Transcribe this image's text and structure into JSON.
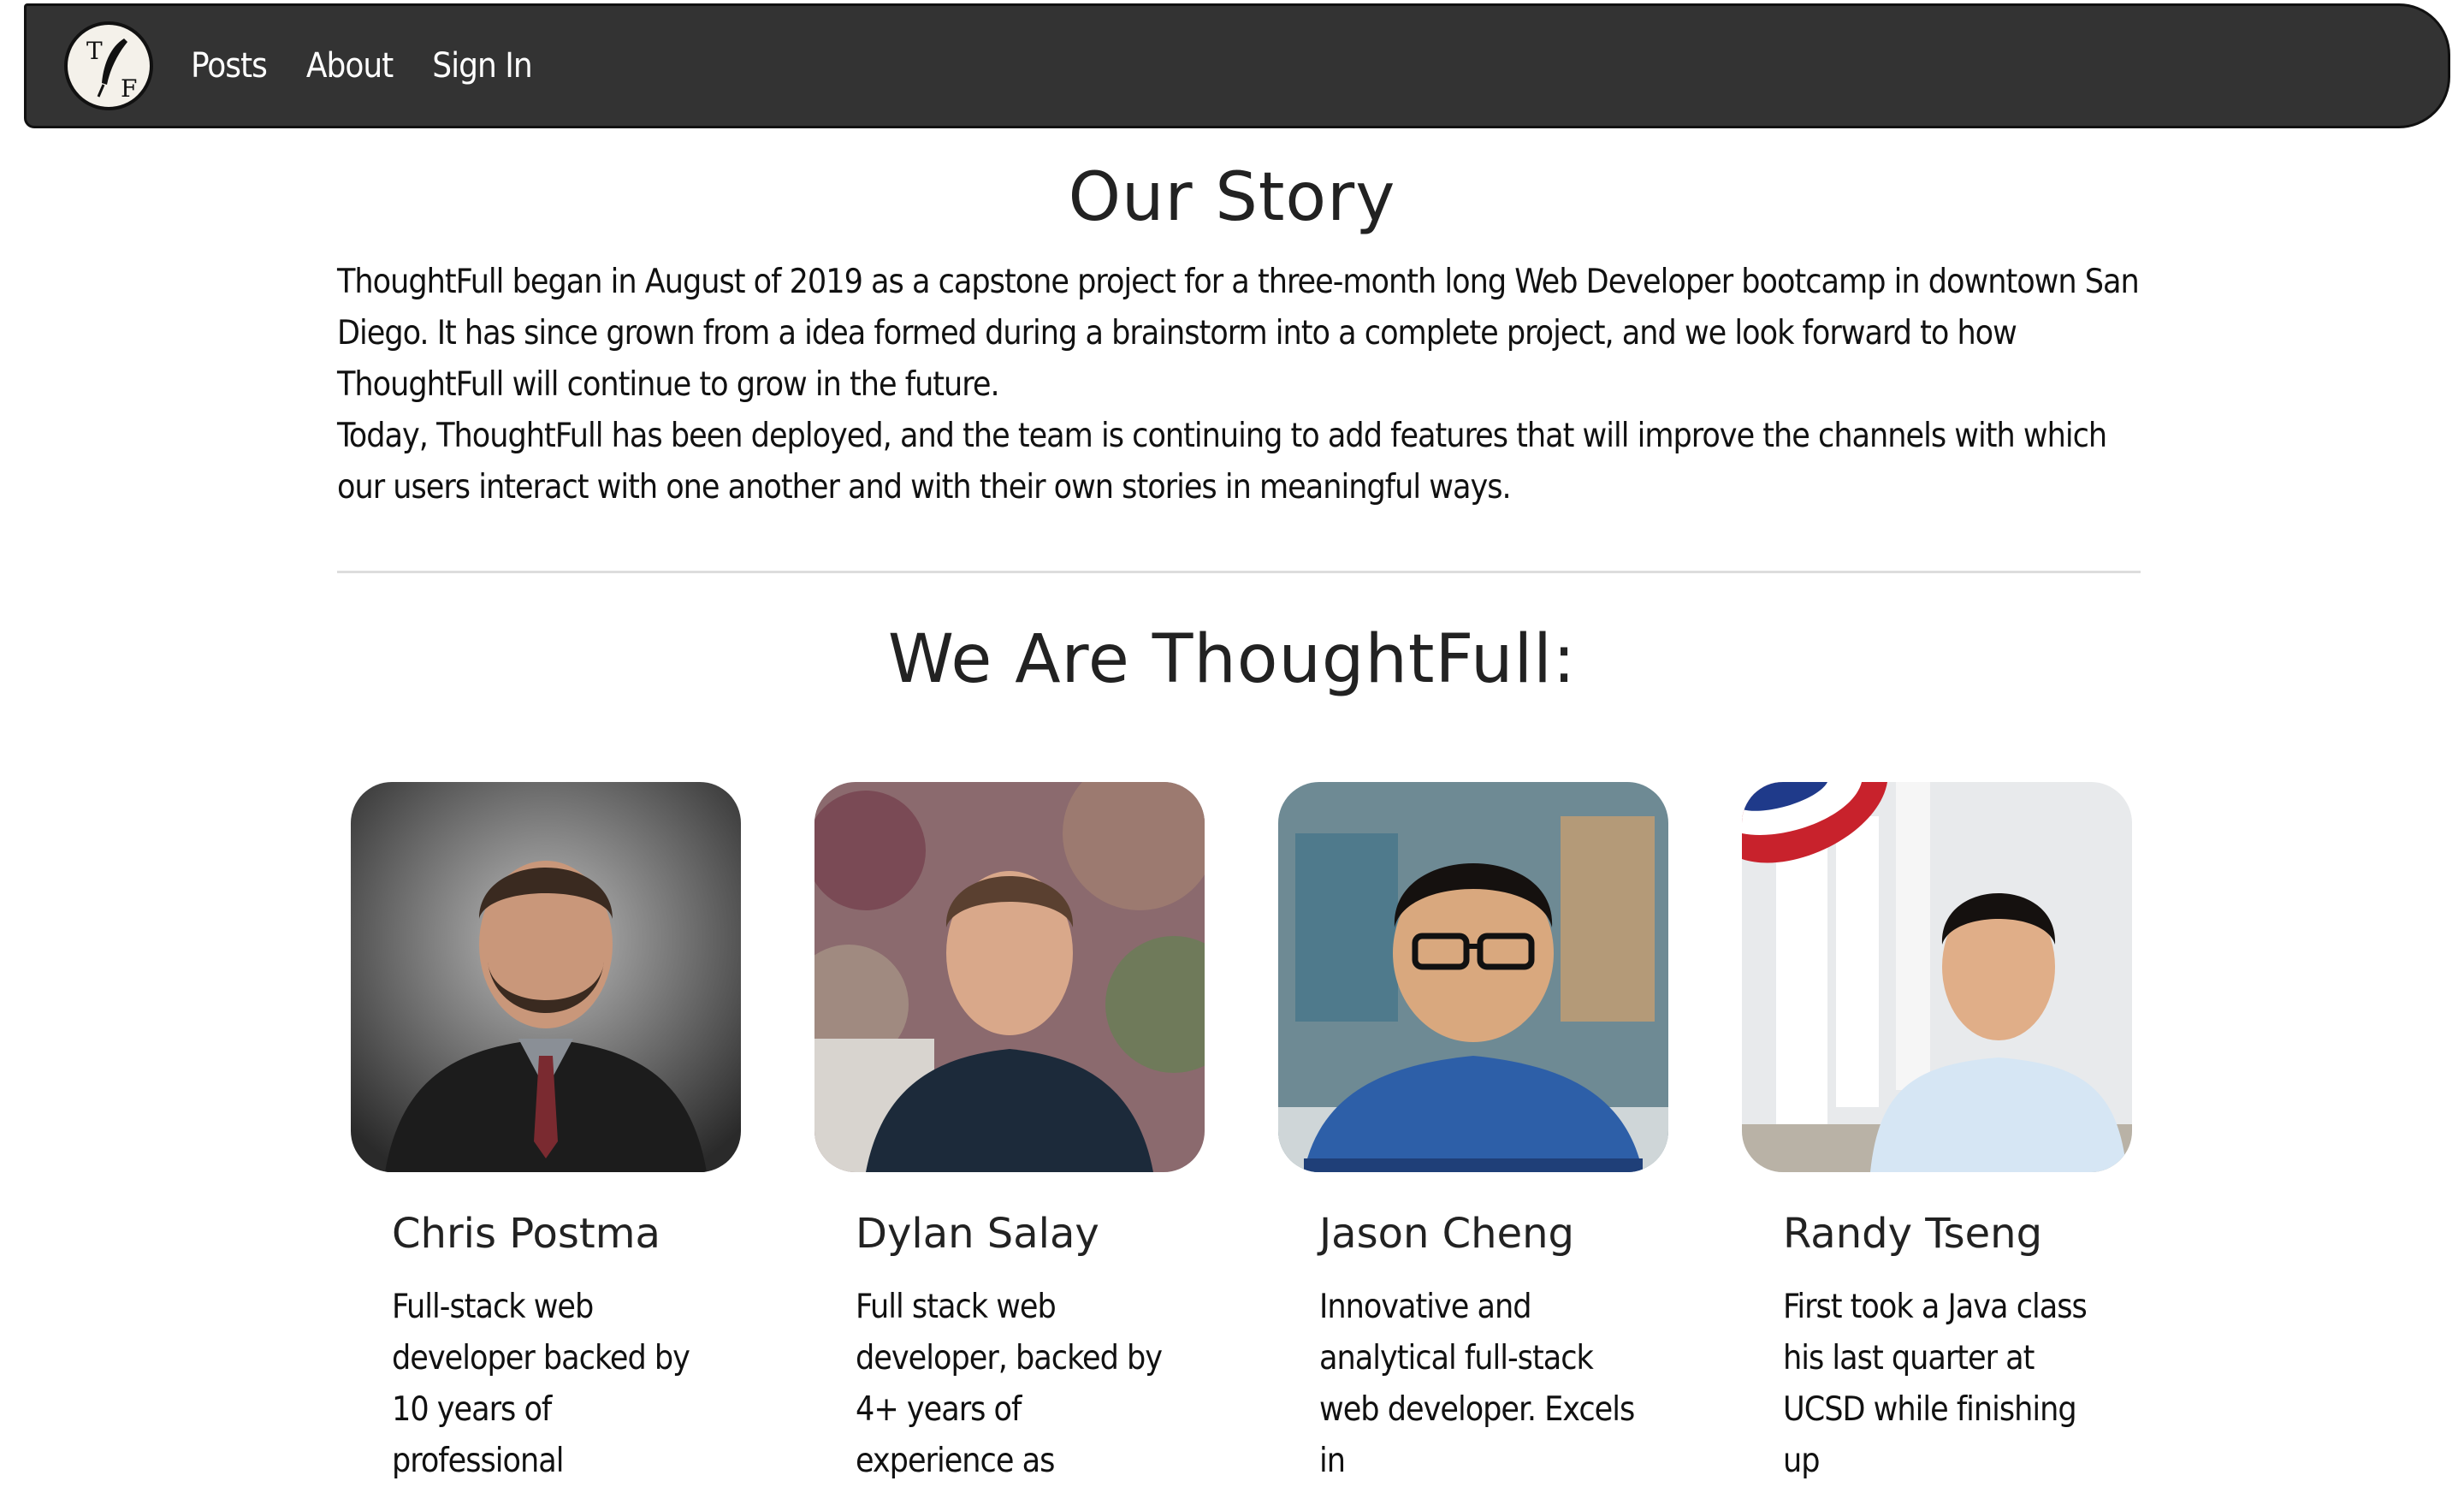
{
  "nav": {
    "logo_letters": [
      "T",
      "F"
    ],
    "links": [
      "Posts",
      "About",
      "Sign In"
    ]
  },
  "story": {
    "title": "Our Story",
    "paragraphs": [
      "ThoughtFull began in August of 2019 as a capstone project for a three-month long Web Developer bootcamp in downtown San Diego. It has since grown from a idea formed during a brainstorm into a complete project, and we look forward to how ThoughtFull will continue to grow in the future.",
      "Today, ThoughtFull has been deployed, and the team is continuing to add features that will improve the channels with which our users interact with one another and with their own stories in meaningful ways."
    ]
  },
  "team": {
    "title": "We Are ThoughtFull:",
    "members": [
      {
        "name": "Chris Postma",
        "bio": "Full-stack web developer backed by 10 years of professional"
      },
      {
        "name": "Dylan Salay",
        "bio": "Full stack web developer, backed by 4+ years of experience as"
      },
      {
        "name": "Jason Cheng",
        "bio": "Innovative and analytical full-stack web developer. Excels in"
      },
      {
        "name": "Randy Tseng",
        "bio": "First took a Java class his last quarter at UCSD while finishing up"
      }
    ]
  },
  "colors": {
    "navbar": "#333333",
    "text": "#222222",
    "divider": "#dddddd"
  }
}
